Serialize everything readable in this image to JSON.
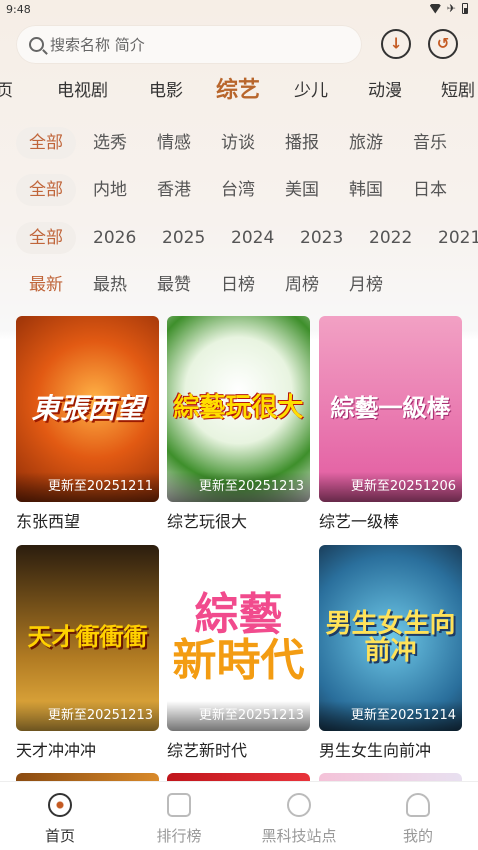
{
  "status": {
    "time": "9:48"
  },
  "search": {
    "placeholder": "搜索名称 简介"
  },
  "tabs": [
    "页",
    "电视剧",
    "电影",
    "综艺",
    "少儿",
    "动漫",
    "短剧"
  ],
  "filters": {
    "type": [
      "全部",
      "选秀",
      "情感",
      "访谈",
      "播报",
      "旅游",
      "音乐"
    ],
    "region": [
      "全部",
      "内地",
      "香港",
      "台湾",
      "美国",
      "韩国",
      "日本"
    ],
    "year": [
      "全部",
      "2026",
      "2025",
      "2024",
      "2023",
      "2022",
      "2021"
    ],
    "sort": [
      "最新",
      "最热",
      "最赞",
      "日榜",
      "周榜",
      "月榜"
    ]
  },
  "items": [
    {
      "title": "东张西望",
      "update": "更新至20251211",
      "logo": "東張西望"
    },
    {
      "title": "综艺玩很大",
      "update": "更新至20251213",
      "logo": "綜藝玩很大"
    },
    {
      "title": "综艺一级棒",
      "update": "更新至20251206",
      "logo": "綜藝一級棒"
    },
    {
      "title": "天才冲冲冲",
      "update": "更新至20251213",
      "logo": "天才衝衝衝"
    },
    {
      "title": "综艺新时代",
      "update": "更新至20251213",
      "logo": "綜藝",
      "logo2": "新時代"
    },
    {
      "title": "男生女生向前冲",
      "update": "更新至20251214",
      "logo": "男生女生向前冲"
    }
  ],
  "nav": [
    "首页",
    "排行榜",
    "黑科技站点",
    "我的"
  ]
}
